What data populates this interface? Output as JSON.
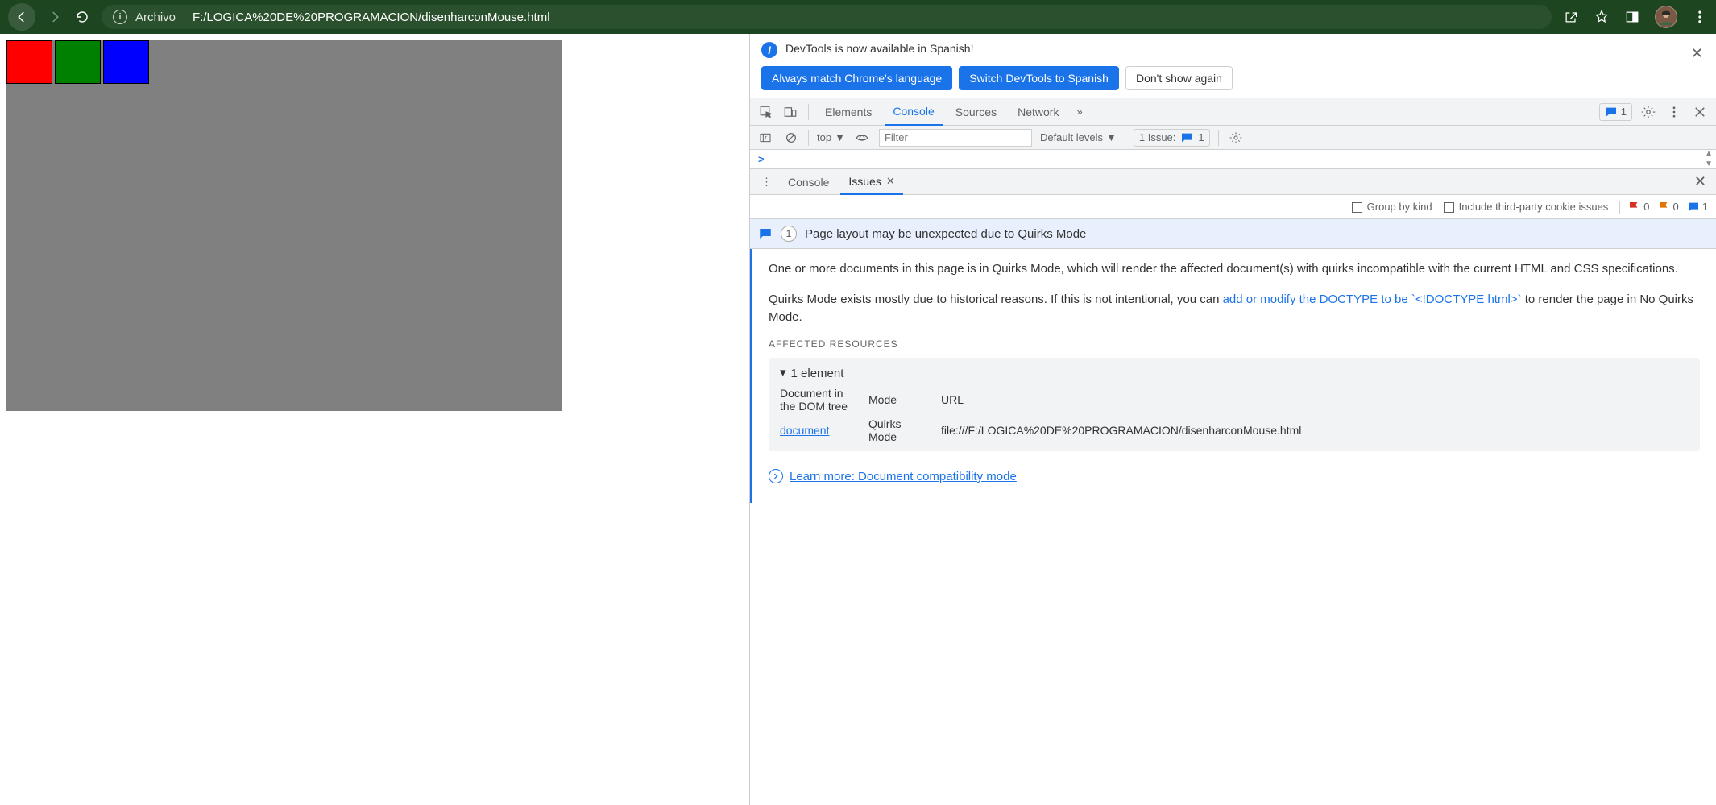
{
  "browser": {
    "url_prefix": "Archivo",
    "url": "F:/LOGICA%20DE%20PROGRAMACION/disenharconMouse.html"
  },
  "swatches": [
    "red",
    "green",
    "blue"
  ],
  "info_banner": {
    "text": "DevTools is now available in Spanish!",
    "btn_match": "Always match Chrome's language",
    "btn_switch": "Switch DevTools to Spanish",
    "btn_dont": "Don't show again"
  },
  "devtools_tabs": {
    "elements": "Elements",
    "console": "Console",
    "sources": "Sources",
    "network": "Network",
    "badge_count": "1"
  },
  "console_bar": {
    "context": "top",
    "filter_placeholder": "Filter",
    "levels": "Default levels",
    "issues_label": "1 Issue:",
    "issues_count": "1"
  },
  "console_prompt": ">",
  "drawer": {
    "console": "Console",
    "issues": "Issues"
  },
  "issues_toolbar": {
    "group": "Group by kind",
    "third_party": "Include third-party cookie issues",
    "red": "0",
    "orange": "0",
    "blue": "1"
  },
  "issue": {
    "count": "1",
    "title": "Page layout may be unexpected due to Quirks Mode",
    "para1": "One or more documents in this page is in Quirks Mode, which will render the affected document(s) with quirks incompatible with the current HTML and CSS specifications.",
    "para2a": "Quirks Mode exists mostly due to historical reasons. If this is not intentional, you can ",
    "para2_link": "add or modify the DOCTYPE to be `<!DOCTYPE html>`",
    "para2b": " to render the page in No Quirks Mode.",
    "affected_title": "Affected Resources",
    "element_header": "1 element",
    "col_doc": "Document in the DOM tree",
    "col_mode": "Mode",
    "col_url": "URL",
    "val_doc": "document",
    "val_mode": "Quirks Mode",
    "val_url": "file:///F:/LOGICA%20DE%20PROGRAMACION/disenharconMouse.html",
    "learn_more": "Learn more: Document compatibility mode"
  }
}
